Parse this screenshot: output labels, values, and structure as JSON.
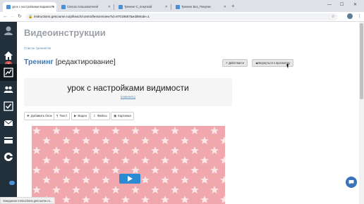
{
  "browser": {
    "tabs": [
      {
        "title": "урок с настройками видимости",
        "active": true
      },
      {
        "title": "Список пользователей",
        "active": false
      },
      {
        "title": "Тренинг С_покупкой",
        "active": false
      },
      {
        "title": "Тренинг Без_Покупки",
        "active": false
      }
    ],
    "url": "instructions.getcourse.ru/pl/teach/control/lesson/view?id=97019587&editMode=1",
    "statusbar": "Ожидание instructions.getcourse.ru..."
  },
  "sidebar": {
    "badge": "4",
    "items": [
      {
        "icon": "avatar-icon"
      },
      {
        "icon": "notifications-icon"
      },
      {
        "icon": "home-icon"
      },
      {
        "icon": "chart-icon"
      },
      {
        "icon": "users-icon"
      },
      {
        "icon": "tasks-icon"
      },
      {
        "icon": "mail-icon"
      },
      {
        "icon": "sales-icon"
      },
      {
        "icon": "logo-icon"
      }
    ]
  },
  "page": {
    "title": "Видеоинструкции",
    "breadcrumb": "Список тренингов",
    "heading_prefix": "Тренинг",
    "heading_suffix": "[редактирование]",
    "actions_label": "Действия",
    "back_label": "Вернуться к просмотру",
    "lesson_title": "урок с настройками видимости",
    "rename_label": "(изменить)",
    "add_buttons": [
      {
        "label": "Добавить блок",
        "icon": "plus-icon"
      },
      {
        "label": "Текст",
        "icon": "text-icon"
      },
      {
        "label": "Видео",
        "icon": "video-icon"
      },
      {
        "label": "Файлы",
        "icon": "files-icon"
      },
      {
        "label": "Картинка",
        "icon": "image-icon"
      }
    ]
  },
  "colors": {
    "sidebar_bg": "#22303c",
    "accent_blue": "#3b7ab8",
    "video_pink": "#f0a8ae",
    "play_blue": "#2a8ad4",
    "badge_red": "#d9534f"
  }
}
